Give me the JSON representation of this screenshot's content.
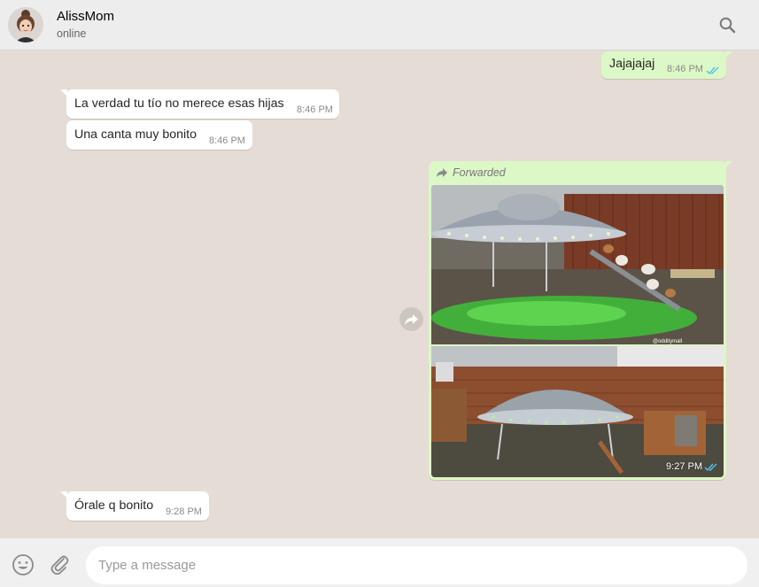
{
  "header": {
    "contact_name": "AlissMom",
    "status": "online",
    "search_icon": "search-icon"
  },
  "messages": [
    {
      "direction": "out",
      "text": "Jajajajaj",
      "time": "8:46 PM",
      "read": true
    },
    {
      "direction": "in",
      "text": "La verdad tu tío no merece esas hijas",
      "time": "8:46 PM"
    },
    {
      "direction": "in",
      "text": "Una canta muy bonito",
      "time": "8:46 PM"
    },
    {
      "direction": "out",
      "type": "image",
      "forwarded_label": "Forwarded",
      "time": "9:27 PM",
      "read": true,
      "image_watermark": "@odditymall"
    },
    {
      "direction": "in",
      "text": "Órale q bonito",
      "time": "9:28 PM"
    }
  ],
  "composer": {
    "placeholder": "Type a message",
    "emoji_icon": "emoji-icon",
    "attach_icon": "paperclip-icon"
  },
  "colors": {
    "header_bg": "#ededed",
    "chat_bg": "#e5ddd5",
    "incoming_bubble": "#ffffff",
    "outgoing_bubble": "#dcf8c6",
    "read_ticks": "#4fc3f7"
  }
}
